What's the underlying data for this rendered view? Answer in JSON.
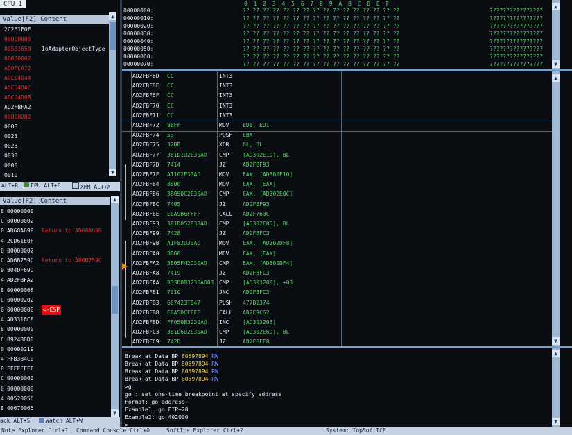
{
  "cpu_tab": "CPU 1",
  "registers": {
    "header": "Value[F2] Content",
    "rows": [
      {
        "value": "2C261E0F",
        "content": "",
        "color": "white"
      },
      {
        "value": "00000000",
        "content": "",
        "color": "red"
      },
      {
        "value": "80583658",
        "content": "IoAdapterObjectType",
        "color": "red"
      },
      {
        "value": "00000002",
        "content": "",
        "color": "red"
      },
      {
        "value": "AD0FCA72",
        "content": "",
        "color": "red"
      },
      {
        "value": "ADC04D44",
        "content": "",
        "color": "red"
      },
      {
        "value": "ADC04DAC",
        "content": "",
        "color": "red"
      },
      {
        "value": "ADC04D08",
        "content": "",
        "color": "red"
      },
      {
        "value": "AD2FBFA2",
        "content": "",
        "color": "white"
      },
      {
        "value": "00000202",
        "content": "",
        "color": "red"
      },
      {
        "value": "0008",
        "content": "",
        "color": "white"
      },
      {
        "value": "0023",
        "content": "",
        "color": "white"
      },
      {
        "value": "0023",
        "content": "",
        "color": "white"
      },
      {
        "value": "0030",
        "content": "",
        "color": "white"
      },
      {
        "value": "0000",
        "content": "",
        "color": "white"
      },
      {
        "value": "0010",
        "content": "",
        "color": "white"
      }
    ]
  },
  "reg_tabs": [
    "ALT+R",
    "FPU ALT+F",
    "XMM ALT+X"
  ],
  "stack": {
    "header": "Value[F2] Content",
    "rows": [
      {
        "value": "00000000",
        "comment": "",
        "ccolor": ""
      },
      {
        "value": "00000002",
        "comment": "",
        "ccolor": ""
      },
      {
        "value": "AD68A699",
        "comment": "Return to AD68A699",
        "ccolor": "red"
      },
      {
        "value": "2CD61E0F",
        "comment": "",
        "ccolor": ""
      },
      {
        "value": "00000002",
        "comment": "",
        "ccolor": ""
      },
      {
        "value": "AD6B759C",
        "comment": "Return to AD6B759C",
        "ccolor": "red"
      },
      {
        "value": "804DF69D",
        "comment": "",
        "ccolor": "blue"
      },
      {
        "value": "AD2FBFA2",
        "comment": "",
        "ccolor": ""
      },
      {
        "value": "00000008",
        "comment": "",
        "ccolor": ""
      },
      {
        "value": "00000202",
        "comment": "",
        "ccolor": ""
      },
      {
        "value": "00000000",
        "comment": "<-ESP",
        "ccolor": "esp"
      },
      {
        "value": "AD3316C8",
        "comment": "",
        "ccolor": ""
      },
      {
        "value": "00000000",
        "comment": "",
        "ccolor": ""
      },
      {
        "value": "8924B8D8",
        "comment": "",
        "ccolor": ""
      },
      {
        "value": "00000219",
        "comment": "",
        "ccolor": ""
      },
      {
        "value": "FFB3B4C0",
        "comment": "",
        "ccolor": ""
      },
      {
        "value": "FFFFFFFF",
        "comment": "",
        "ccolor": ""
      },
      {
        "value": "00000000",
        "comment": "",
        "ccolor": ""
      },
      {
        "value": "00000000",
        "comment": "",
        "ccolor": ""
      },
      {
        "value": "0052005C",
        "comment": "",
        "ccolor": ""
      },
      {
        "value": "00670065",
        "comment": "",
        "ccolor": ""
      }
    ],
    "prefixes": [
      "8",
      "C",
      "0",
      "4",
      "8",
      "C",
      "0",
      "4",
      "8",
      "C",
      "0",
      "4",
      "8",
      "C",
      "0",
      "4",
      "8",
      "C",
      "0",
      "4",
      "8"
    ]
  },
  "bottom_tabs": [
    "ack ALT+S",
    "Watch ALT+W"
  ],
  "hex": {
    "header": "0 1 2 3 4 5 6 7 8 9 A B C D E F",
    "addresses": [
      "00000000:",
      "00000010:",
      "00000020:",
      "00000030:",
      "00000040:",
      "00000050:",
      "00000060:",
      "00000070:"
    ],
    "bytes": "?? ?? ?? ?? ?? ?? ?? ?? ?? ?? ?? ?? ?? ?? ?? ??",
    "ascii": "????????????????"
  },
  "disasm": {
    "rows": [
      {
        "addr": "AD2FBF6D",
        "bytes": "CC",
        "mn": "INT3",
        "op": ""
      },
      {
        "addr": "AD2FBF6E",
        "bytes": "CC",
        "mn": "INT3",
        "op": ""
      },
      {
        "addr": "AD2FBF6F",
        "bytes": "CC",
        "mn": "INT3",
        "op": ""
      },
      {
        "addr": "AD2FBF70",
        "bytes": "CC",
        "mn": "INT3",
        "op": ""
      },
      {
        "addr": "AD2FBF71",
        "bytes": "CC",
        "mn": "INT3",
        "op": ""
      },
      {
        "addr": "AD2FBF72",
        "bytes": "8BFF",
        "mn": "MOV",
        "op": "EDI, EDI"
      },
      {
        "addr": "AD2FBF74",
        "bytes": "53",
        "mn": "PUSH",
        "op": "EBX"
      },
      {
        "addr": "AD2FBF75",
        "bytes": "32DB",
        "mn": "XOR",
        "op": "BL, BL"
      },
      {
        "addr": "AD2FBF77",
        "bytes": "381D1D2E30AD",
        "mn": "CMP",
        "op": "[AD302E1D], BL"
      },
      {
        "addr": "AD2FBF7D",
        "bytes": "7414",
        "mn": "JZ",
        "op": "AD2FBF93"
      },
      {
        "addr": "AD2FBF7F",
        "bytes": "A1102E30AD",
        "mn": "MOV",
        "op": "EAX, [AD302E10]"
      },
      {
        "addr": "AD2FBF84",
        "bytes": "8B00",
        "mn": "MOV",
        "op": "EAX, [EAX]"
      },
      {
        "addr": "AD2FBF86",
        "bytes": "3B050C2E30AD",
        "mn": "CMP",
        "op": "EAX, [AD302E0C]"
      },
      {
        "addr": "AD2FBF8C",
        "bytes": "7405",
        "mn": "JZ",
        "op": "AD2FBF93"
      },
      {
        "addr": "AD2FBF8E",
        "bytes": "E8A9B6FFFF",
        "mn": "CALL",
        "op": "AD2F763C"
      },
      {
        "addr": "AD2FBF93",
        "bytes": "381D052E30AD",
        "mn": "CMP",
        "op": "[AD302E05], BL"
      },
      {
        "addr": "AD2FBF99",
        "bytes": "7428",
        "mn": "JZ",
        "op": "AD2FBFC3"
      },
      {
        "addr": "AD2FBF9B",
        "bytes": "A1F82D30AD",
        "mn": "MOV",
        "op": "EAX, [AD302DF8]"
      },
      {
        "addr": "AD2FBFA0",
        "bytes": "8B00",
        "mn": "MOV",
        "op": "EAX, [EAX]"
      },
      {
        "addr": "AD2FBFA2",
        "bytes": "3B05F42D30AD",
        "mn": "CMP",
        "op": "EAX, [AD302DF4]"
      },
      {
        "addr": "AD2FBFA8",
        "bytes": "7419",
        "mn": "JZ",
        "op": "AD2FBFC3"
      },
      {
        "addr": "AD2FBFAA",
        "bytes": "833D083230AD03",
        "mn": "CMP",
        "op": "[AD303208], +03"
      },
      {
        "addr": "AD2FBFB1",
        "bytes": "7310",
        "mn": "JNC",
        "op": "AD2FBFC3"
      },
      {
        "addr": "AD2FBFB3",
        "bytes": "687423TB47",
        "mn": "PUSH",
        "op": "477B2374"
      },
      {
        "addr": "AD2FBFB8",
        "bytes": "E8A5DCFFFF",
        "mn": "CALL",
        "op": "AD2F9C62"
      },
      {
        "addr": "AD2FBFBD",
        "bytes": "FF05083230AD",
        "mn": "INC",
        "op": "[AD303208]"
      },
      {
        "addr": "AD2FBFC3",
        "bytes": "381D6D2E30AD",
        "mn": "CMP",
        "op": "[AD302E6D], BL"
      },
      {
        "addr": "AD2FBFC9",
        "bytes": "742D",
        "mn": "JZ",
        "op": "AD2FBFF8"
      }
    ]
  },
  "console": {
    "lines": [
      {
        "a": "Break at Data BP ",
        "b": "80597894",
        "c": " RW"
      },
      {
        "a": "Break at Data BP ",
        "b": "80597894",
        "c": " RW"
      },
      {
        "a": "Break at Data BP ",
        "b": "80597894",
        "c": " RW"
      },
      {
        "a": "Break at Data BP ",
        "b": "80597894",
        "c": " RW"
      }
    ],
    "help": [
      ">g",
      "go : set one-time breakpoint at specify address",
      "Format: go address",
      "Example1: go EIP+20",
      "Example2: go 402000",
      ">"
    ]
  },
  "status": {
    "left": "Note Explorer Ctrl+1",
    "mid1": "Command Console Ctrl+0",
    "mid2": "SoftIce Explorer Ctrl+2",
    "right": "System: TopSoftICE"
  }
}
